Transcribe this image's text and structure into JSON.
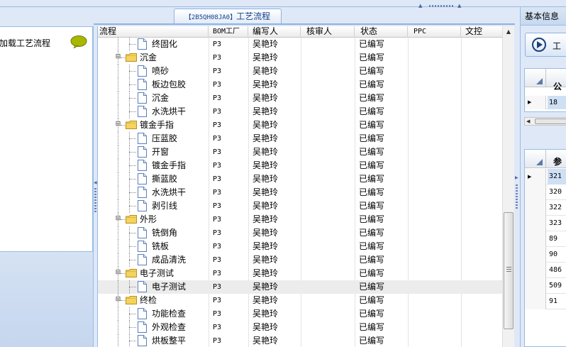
{
  "document_tab": {
    "code": "【2B5QH08JA0】",
    "title": "工艺流程"
  },
  "left_panel": {
    "load_label": "点加载工艺流程",
    "bubble_icon": "speech-bubble-icon"
  },
  "grid": {
    "columns": [
      "流程",
      "BOM工厂",
      "编写人",
      "核审人",
      "状态",
      "PPC",
      "文控"
    ],
    "rows": [
      {
        "name": "终固化",
        "type": "doc",
        "level": 1,
        "bom": "P3",
        "writer": "吴艳玲",
        "reviewer": "",
        "status": "已编写"
      },
      {
        "name": "沉金",
        "type": "folder",
        "level": 0,
        "bom": "P3",
        "writer": "吴艳玲",
        "reviewer": "",
        "status": "已编写"
      },
      {
        "name": "喷砂",
        "type": "doc",
        "level": 1,
        "bom": "P3",
        "writer": "吴艳玲",
        "reviewer": "",
        "status": "已编写"
      },
      {
        "name": "板边包胶",
        "type": "doc",
        "level": 1,
        "bom": "P3",
        "writer": "吴艳玲",
        "reviewer": "",
        "status": "已编写"
      },
      {
        "name": "沉金",
        "type": "doc",
        "level": 1,
        "bom": "P3",
        "writer": "吴艳玲",
        "reviewer": "",
        "status": "已编写"
      },
      {
        "name": "水洗烘干",
        "type": "doc",
        "level": 1,
        "bom": "P3",
        "writer": "吴艳玲",
        "reviewer": "",
        "status": "已编写"
      },
      {
        "name": "镀金手指",
        "type": "folder",
        "level": 0,
        "bom": "P3",
        "writer": "吴艳玲",
        "reviewer": "",
        "status": "已编写"
      },
      {
        "name": "压蓝胶",
        "type": "doc",
        "level": 1,
        "bom": "P3",
        "writer": "吴艳玲",
        "reviewer": "",
        "status": "已编写"
      },
      {
        "name": "开窗",
        "type": "doc",
        "level": 1,
        "bom": "P3",
        "writer": "吴艳玲",
        "reviewer": "",
        "status": "已编写"
      },
      {
        "name": "镀金手指",
        "type": "doc",
        "level": 1,
        "bom": "P3",
        "writer": "吴艳玲",
        "reviewer": "",
        "status": "已编写"
      },
      {
        "name": "撕蓝胶",
        "type": "doc",
        "level": 1,
        "bom": "P3",
        "writer": "吴艳玲",
        "reviewer": "",
        "status": "已编写"
      },
      {
        "name": "水洗烘干",
        "type": "doc",
        "level": 1,
        "bom": "P3",
        "writer": "吴艳玲",
        "reviewer": "",
        "status": "已编写"
      },
      {
        "name": "剥引线",
        "type": "doc",
        "level": 1,
        "bom": "P3",
        "writer": "吴艳玲",
        "reviewer": "",
        "status": "已编写"
      },
      {
        "name": "外形",
        "type": "folder",
        "level": 0,
        "bom": "P3",
        "writer": "吴艳玲",
        "reviewer": "",
        "status": "已编写"
      },
      {
        "name": "铣倒角",
        "type": "doc",
        "level": 1,
        "bom": "P3",
        "writer": "吴艳玲",
        "reviewer": "",
        "status": "已编写"
      },
      {
        "name": "铣板",
        "type": "doc",
        "level": 1,
        "bom": "P3",
        "writer": "吴艳玲",
        "reviewer": "",
        "status": "已编写"
      },
      {
        "name": "成品清洗",
        "type": "doc",
        "level": 1,
        "bom": "P3",
        "writer": "吴艳玲",
        "reviewer": "",
        "status": "已编写"
      },
      {
        "name": "电子测试",
        "type": "folder",
        "level": 0,
        "bom": "P3",
        "writer": "吴艳玲",
        "reviewer": "",
        "status": "已编写"
      },
      {
        "name": "电子测试",
        "type": "doc",
        "level": 1,
        "bom": "P3",
        "writer": "吴艳玲",
        "reviewer": "",
        "status": "已编写",
        "selected": true
      },
      {
        "name": "终检",
        "type": "folder",
        "level": 0,
        "bom": "P3",
        "writer": "吴艳玲",
        "reviewer": "",
        "status": "已编写"
      },
      {
        "name": "功能检查",
        "type": "doc",
        "level": 1,
        "bom": "P3",
        "writer": "吴艳玲",
        "reviewer": "",
        "status": "已编写"
      },
      {
        "name": "外观检查",
        "type": "doc",
        "level": 1,
        "bom": "P3",
        "writer": "吴艳玲",
        "reviewer": "",
        "status": "已编写"
      },
      {
        "name": "烘板整平",
        "type": "doc",
        "level": 1,
        "bom": "P3",
        "writer": "吴艳玲",
        "reviewer": "",
        "status": "已编写"
      }
    ]
  },
  "right_panel": {
    "title": "基本信息",
    "craft_button_label": "工",
    "grid1": {
      "header": "公",
      "rows": [
        "18"
      ]
    },
    "grid2": {
      "header": "参",
      "rows": [
        "321",
        "320",
        "322",
        "323",
        "89",
        "90",
        "486",
        "509",
        "91"
      ]
    }
  }
}
